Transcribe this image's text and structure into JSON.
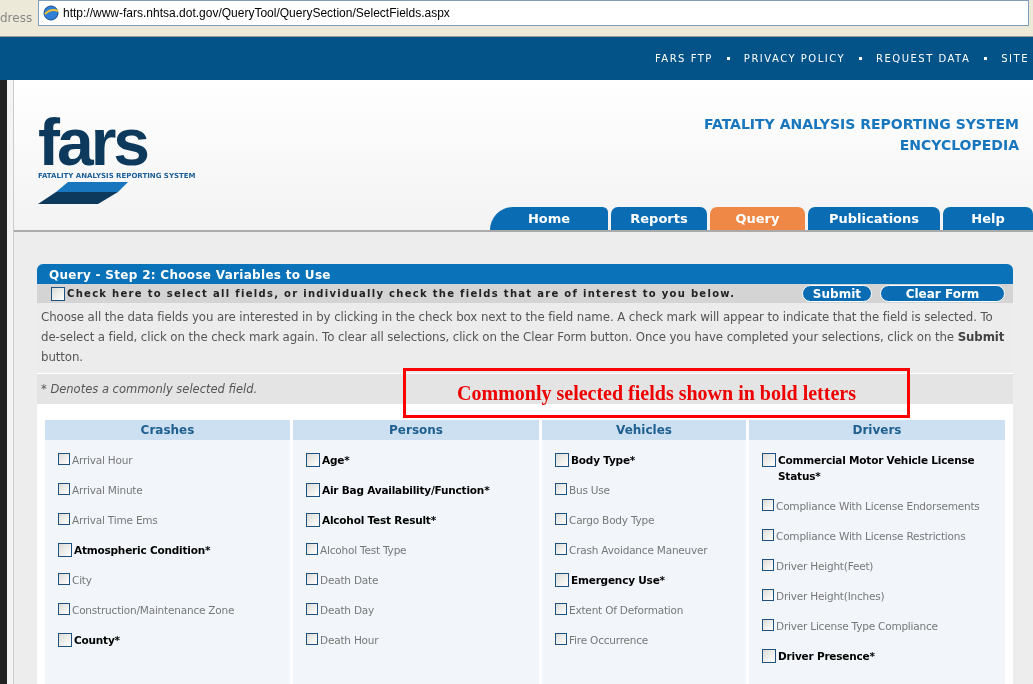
{
  "address_bar": {
    "label": "dress",
    "url": "http://www-fars.nhtsa.dot.gov/QueryTool/QuerySection/SelectFields.aspx"
  },
  "top_links": [
    "FARS FTP",
    "PRIVACY POLICY",
    "REQUEST DATA",
    "SITE"
  ],
  "logo": {
    "wordmark": "fars",
    "tagline": "FATALITY ANALYSIS REPORTING SYSTEM"
  },
  "site_title": [
    "FATALITY ANALYSIS REPORTING SYSTEM",
    "ENCYCLOPEDIA"
  ],
  "tabs": [
    {
      "label": "Home",
      "selected": false
    },
    {
      "label": "Reports",
      "selected": false
    },
    {
      "label": "Query",
      "selected": true
    },
    {
      "label": "Publications",
      "selected": false
    },
    {
      "label": "Help",
      "selected": false
    }
  ],
  "panel": {
    "title": "Query - Step 2: Choose Variables to Use",
    "select_all": {
      "label": "Check here to select all fields, or individually check the fields that are of interest to you below.",
      "checked": false
    },
    "buttons": [
      "Submit",
      "Clear Form"
    ],
    "instructions": "Choose all the data fields you are interested in by clicking in the check box next to the field name. A check mark will appear to indicate that the field is selected. To de-select a field, click on the check mark again. To clear all selections, click on the Clear Form button. Once you have completed your selections, click on the **Submit** button.",
    "note": "* Denotes a commonly selected field.",
    "columns": [
      {
        "title": "Crashes",
        "fields": [
          {
            "label": "Arrival Hour",
            "common": false,
            "checked": false
          },
          {
            "label": "Arrival Minute",
            "common": false,
            "checked": false
          },
          {
            "label": "Arrival Time Ems",
            "common": false,
            "checked": false
          },
          {
            "label": "Atmospheric Condition*",
            "common": true,
            "checked": false
          },
          {
            "label": "City",
            "common": false,
            "checked": false
          },
          {
            "label": "Construction/Maintenance Zone",
            "common": false,
            "checked": false
          },
          {
            "label": "County*",
            "common": true,
            "checked": false
          }
        ]
      },
      {
        "title": "Persons",
        "fields": [
          {
            "label": "Age*",
            "common": true,
            "checked": false
          },
          {
            "label": "Air Bag Availability/Function*",
            "common": true,
            "checked": false
          },
          {
            "label": "Alcohol Test Result*",
            "common": true,
            "checked": false
          },
          {
            "label": "Alcohol Test Type",
            "common": false,
            "checked": false
          },
          {
            "label": "Death Date",
            "common": false,
            "checked": false
          },
          {
            "label": "Death Day",
            "common": false,
            "checked": false
          },
          {
            "label": "Death Hour",
            "common": false,
            "checked": false
          }
        ]
      },
      {
        "title": "Vehicles",
        "fields": [
          {
            "label": "Body Type*",
            "common": true,
            "checked": false
          },
          {
            "label": "Bus Use",
            "common": false,
            "checked": false
          },
          {
            "label": "Cargo Body Type",
            "common": false,
            "checked": false
          },
          {
            "label": "Crash Avoidance Maneuver",
            "common": false,
            "checked": false
          },
          {
            "label": "Emergency Use*",
            "common": true,
            "checked": false
          },
          {
            "label": "Extent Of Deformation",
            "common": false,
            "checked": false
          },
          {
            "label": "Fire Occurrence",
            "common": false,
            "checked": false
          }
        ]
      },
      {
        "title": "Drivers",
        "fields": [
          {
            "label": "Commercial Motor Vehicle License Status*",
            "common": true,
            "checked": false
          },
          {
            "label": "Compliance With License Endorsements",
            "common": false,
            "checked": false
          },
          {
            "label": "Compliance With License Restrictions",
            "common": false,
            "checked": false
          },
          {
            "label": "Driver Height(Feet)",
            "common": false,
            "checked": false
          },
          {
            "label": "Driver Height(Inches)",
            "common": false,
            "checked": false
          },
          {
            "label": "Driver License Type Compliance",
            "common": false,
            "checked": false
          },
          {
            "label": "Driver Presence*",
            "common": true,
            "checked": false
          }
        ]
      }
    ]
  },
  "annotation": "Commonly selected fields shown in bold letters"
}
